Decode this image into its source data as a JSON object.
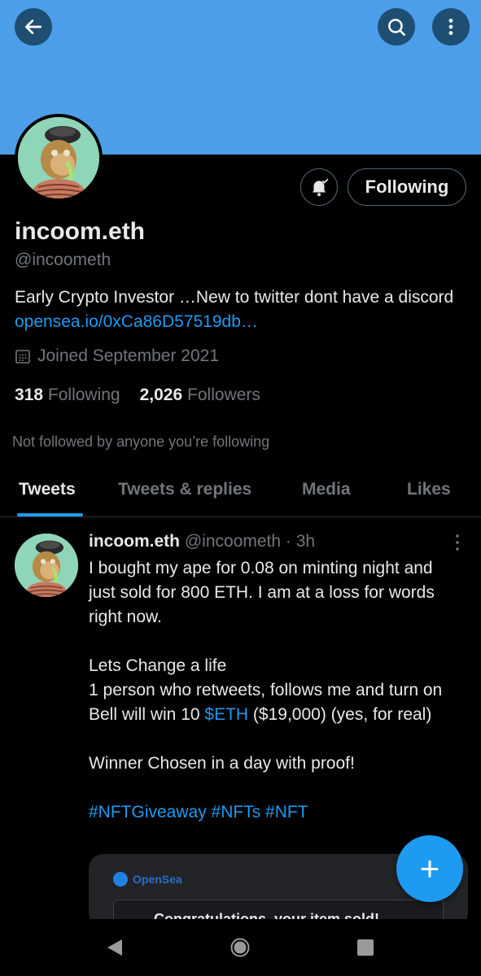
{
  "header": {
    "banner_color": "#4c9ee8",
    "back_icon": "arrow-left-icon",
    "search_icon": "search-icon",
    "more_icon": "more-vertical-icon"
  },
  "profile": {
    "name": "incoom.eth",
    "handle": "@incoometh",
    "bio_text": "Early Crypto Investor …New to twitter dont have a discord",
    "bio_link": "opensea.io/0xCa86D57519db…",
    "joined": "Joined September 2021",
    "following_count": "318",
    "following_label": "Following",
    "followers_count": "2,026",
    "followers_label": "Followers",
    "not_followed": "Not followed by anyone you’re following",
    "follow_button": "Following",
    "notify_icon": "bell-notification-icon"
  },
  "tabs": [
    {
      "label": "Tweets",
      "active": true
    },
    {
      "label": "Tweets & replies",
      "active": false
    },
    {
      "label": "Media",
      "active": false
    },
    {
      "label": "Likes",
      "active": false
    }
  ],
  "tweet": {
    "name": "incoom.eth",
    "handle": "@incoometh",
    "time": "· 3h",
    "line1": "I bought my ape for 0.08 on minting night and just sold for 800 ETH. I am at a loss for words right now.",
    "line2": "Lets Change a life",
    "line3_pre": "1 person who retweets, follows me and turn on Bell will win 10 ",
    "line3_tag": "$ETH",
    "line3_post": " ($19,000) (yes, for real)",
    "line4": "Winner Chosen in a day with proof!",
    "hashtags": "#NFTGiveaway #NFTs #NFT",
    "card_brand": "OpenSea",
    "card_text": "Congratulations, your item sold!"
  },
  "fab": {
    "label": "+"
  },
  "accent": "#1d9bf0"
}
